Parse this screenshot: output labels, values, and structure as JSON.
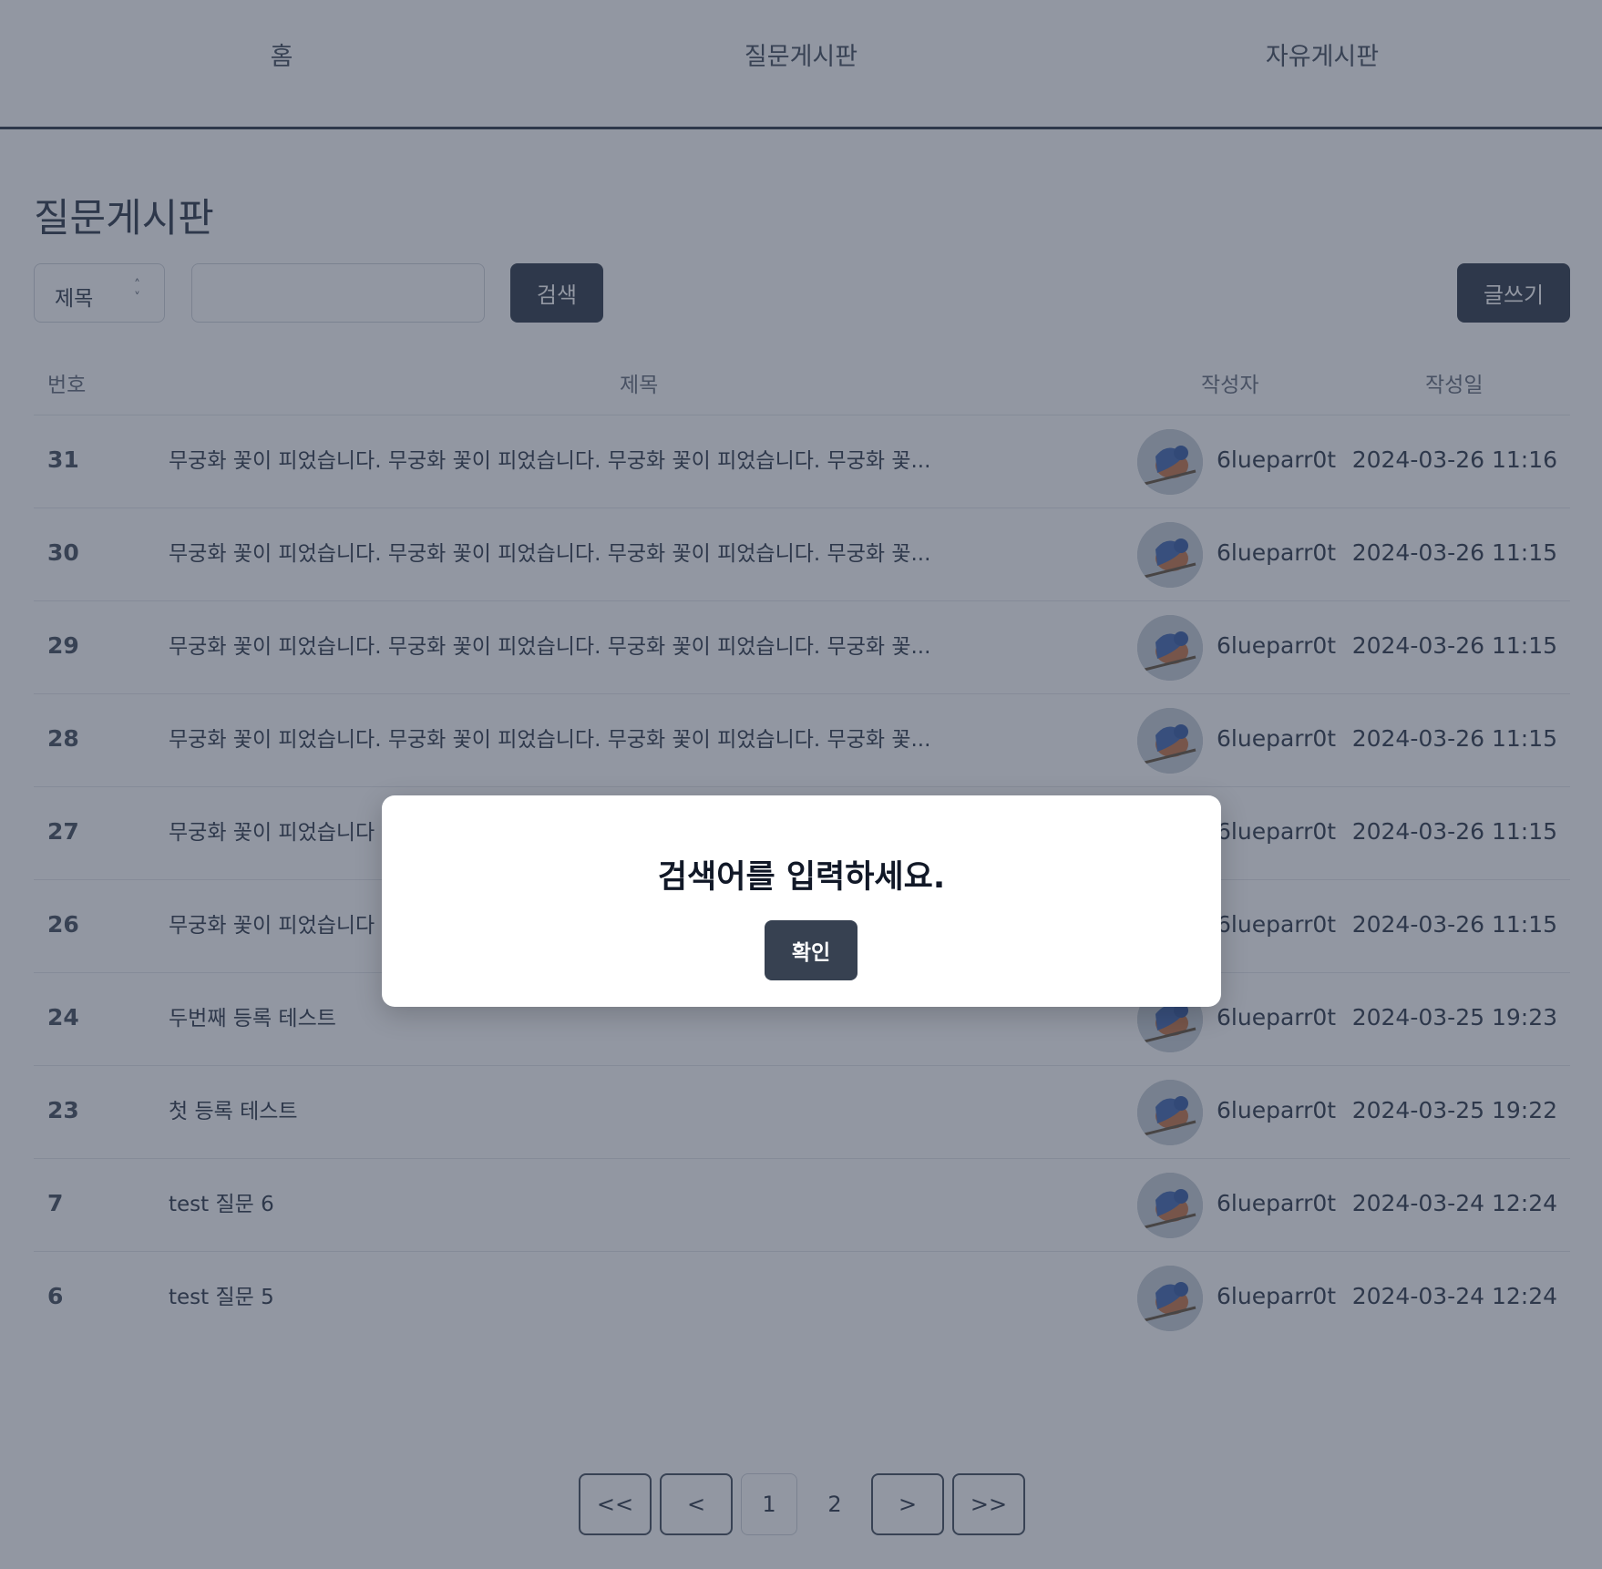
{
  "nav": {
    "items": [
      "홈",
      "질문게시판",
      "자유게시판"
    ]
  },
  "page_title": "질문게시판",
  "toolbar": {
    "select_value": "제목",
    "search_value": "",
    "search_label": "검색",
    "write_label": "글쓰기"
  },
  "table": {
    "headers": [
      "번호",
      "제목",
      "작성자",
      "작성일"
    ],
    "rows": [
      {
        "num": "31",
        "title": "무궁화 꽃이 피었습니다. 무궁화 꽃이 피었습니다. 무궁화 꽃이 피었습니다. 무궁화 꽃...",
        "author": "6lueparr0t",
        "date": "2024-03-26 11:16"
      },
      {
        "num": "30",
        "title": "무궁화 꽃이 피었습니다. 무궁화 꽃이 피었습니다. 무궁화 꽃이 피었습니다. 무궁화 꽃...",
        "author": "6lueparr0t",
        "date": "2024-03-26 11:15"
      },
      {
        "num": "29",
        "title": "무궁화 꽃이 피었습니다. 무궁화 꽃이 피었습니다. 무궁화 꽃이 피었습니다. 무궁화 꽃...",
        "author": "6lueparr0t",
        "date": "2024-03-26 11:15"
      },
      {
        "num": "28",
        "title": "무궁화 꽃이 피었습니다. 무궁화 꽃이 피었습니다. 무궁화 꽃이 피었습니다. 무궁화 꽃...",
        "author": "6lueparr0t",
        "date": "2024-03-26 11:15"
      },
      {
        "num": "27",
        "title": "무궁화 꽃이 피었습니다",
        "author": "6lueparr0t",
        "date": "2024-03-26 11:15"
      },
      {
        "num": "26",
        "title": "무궁화 꽃이 피었습니다",
        "author": "6lueparr0t",
        "date": "2024-03-26 11:15"
      },
      {
        "num": "24",
        "title": "두번째 등록 테스트",
        "author": "6lueparr0t",
        "date": "2024-03-25 19:23"
      },
      {
        "num": "23",
        "title": "첫 등록 테스트",
        "author": "6lueparr0t",
        "date": "2024-03-25 19:22"
      },
      {
        "num": "7",
        "title": "test 질문 6",
        "author": "6lueparr0t",
        "date": "2024-03-24 12:24"
      },
      {
        "num": "6",
        "title": "test 질문 5",
        "author": "6lueparr0t",
        "date": "2024-03-24 12:24"
      }
    ]
  },
  "pagination": {
    "first": "<<",
    "prev": "<",
    "pages": [
      "1",
      "2"
    ],
    "current": "1",
    "next": ">",
    "last": ">>"
  },
  "modal": {
    "message": "검색어를 입력하세요.",
    "confirm_label": "확인"
  },
  "colors": {
    "primary": "#374151",
    "overlay": "rgba(37,47,69,0.5)"
  }
}
